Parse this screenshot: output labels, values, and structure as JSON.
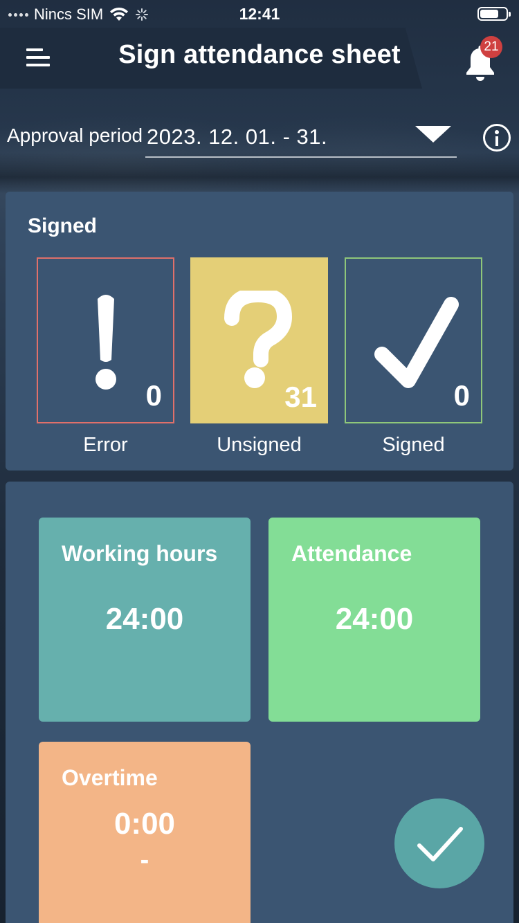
{
  "status_bar": {
    "carrier": "Nincs SIM",
    "time": "12:41"
  },
  "header": {
    "title": "Sign attendance sheet",
    "notification_count": "21",
    "icons": [
      "menu-icon",
      "bell-icon"
    ]
  },
  "period": {
    "label": "Approval period",
    "value": "2023. 12. 01. - 31.",
    "icons": [
      "chevron-down-icon",
      "info-icon"
    ]
  },
  "signed_section": {
    "title": "Signed",
    "items": [
      {
        "label": "Error",
        "count": "0",
        "icon": "exclamation-icon",
        "color": "#e0706a"
      },
      {
        "label": "Unsigned",
        "count": "31",
        "icon": "question-icon",
        "color": "#e4cf77"
      },
      {
        "label": "Signed",
        "count": "0",
        "icon": "checkmark-icon",
        "color": "#8fc77a"
      }
    ]
  },
  "summary": {
    "working_hours": {
      "label": "Working hours",
      "value": "24:00",
      "color": "#66b0ad"
    },
    "attendance": {
      "label": "Attendance",
      "value": "24:00",
      "color": "#83dd96"
    },
    "overtime": {
      "label": "Overtime",
      "value": "0:00",
      "sub": "-",
      "color": "#f3b587"
    }
  },
  "fab": {
    "icon": "checkmark-icon",
    "color": "#5aa6a6"
  }
}
